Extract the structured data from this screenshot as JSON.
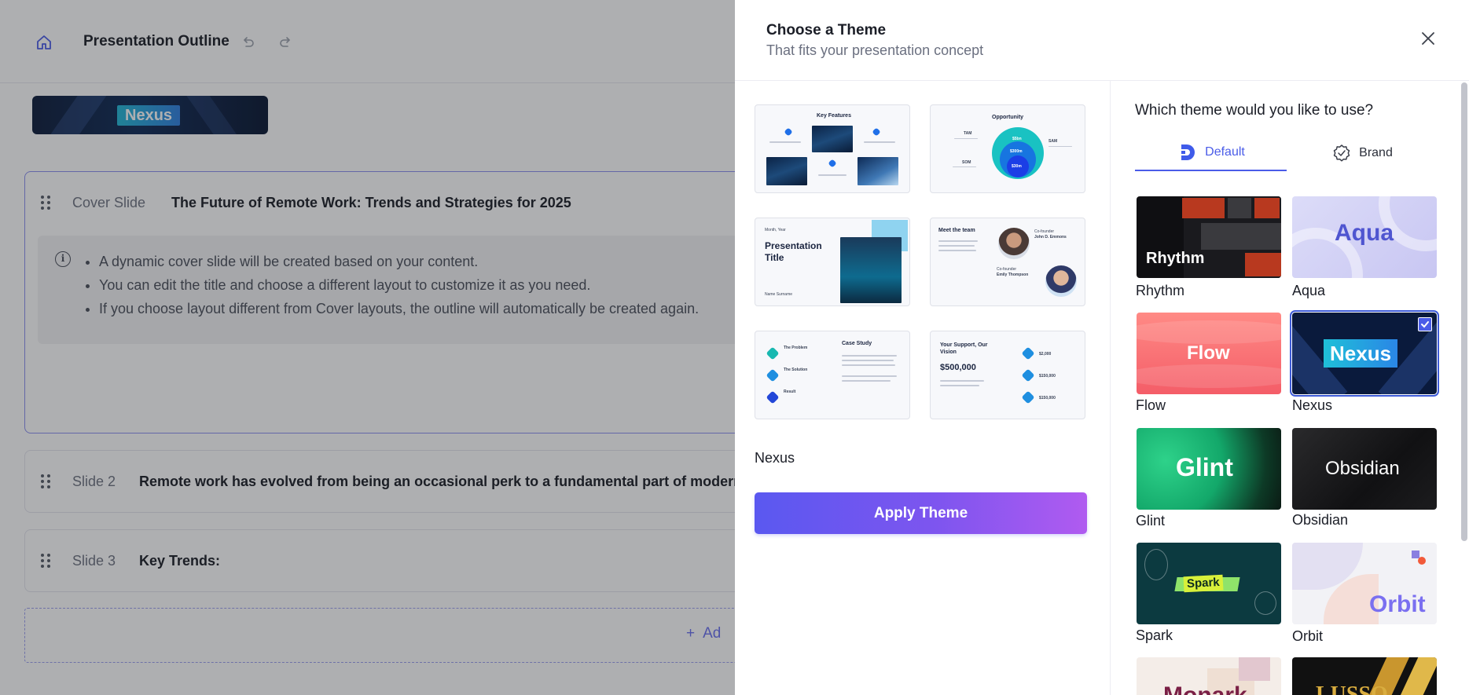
{
  "app": {
    "title": "Presentation Outline",
    "banner_theme": "Nexus",
    "add_slide_label": "Ad"
  },
  "cover": {
    "kind": "Cover Slide",
    "title": "The Future of Remote Work: Trends and Strategies for 2025",
    "info": [
      "A dynamic cover slide will be created based on your content.",
      "You can edit the title and choose a different layout to customize it as you need.",
      "If you choose layout different from Cover layouts, the outline will automatically be created again."
    ]
  },
  "slides": [
    {
      "kind": "Slide 2",
      "title": "Remote work has evolved from being an occasional perk to a fundamental part of modern"
    },
    {
      "kind": "Slide 3",
      "title": "Key Trends:"
    }
  ],
  "panel": {
    "title": "Choose a Theme",
    "subtitle": "That fits your presentation concept",
    "selected_theme": "Nexus",
    "apply_label": "Apply Theme",
    "question": "Which theme would you like to use?",
    "tabs": {
      "default": "Default",
      "brand": "Brand"
    }
  },
  "previews": {
    "key_features": {
      "title": "Key Features"
    },
    "opportunity": {
      "title": "Opportunity",
      "tam": "TAM",
      "sam": "SAM",
      "som": "SOM",
      "v1": "$5bn",
      "v2": "$300m",
      "v3": "$30m"
    },
    "title_slide": {
      "month": "Month, Year",
      "title1": "Presentation",
      "title2": "Title",
      "name": "Name Surname"
    },
    "team": {
      "title": "Meet the team",
      "role1": "Co-founder",
      "name1": "John D. Emmons",
      "role2": "Co-founder",
      "name2": "Emily Thompson"
    },
    "case_study": {
      "title": "Case Study",
      "p1": "The Problem",
      "p2": "The Solution",
      "p3": "Result"
    },
    "support": {
      "title1": "Your Support, Our",
      "title2": "Vision",
      "amount": "$500,000",
      "a1": "$2,000",
      "a2": "$150,000",
      "a3": "$150,000"
    }
  },
  "themes": [
    {
      "name": "Rhythm",
      "tile_text": "Rhythm"
    },
    {
      "name": "Aqua",
      "tile_text": "Aqua"
    },
    {
      "name": "Flow",
      "tile_text": "Flow"
    },
    {
      "name": "Nexus",
      "tile_text": "Nexus",
      "selected": true
    },
    {
      "name": "Glint",
      "tile_text": "Glint"
    },
    {
      "name": "Obsidian",
      "tile_text": "Obsidian"
    },
    {
      "name": "Spark",
      "tile_text": "Spark"
    },
    {
      "name": "Orbit",
      "tile_text": "Orbit"
    },
    {
      "name": "Monark",
      "tile_text": "Monark"
    },
    {
      "name": "Lusso",
      "tile_text": "LUSSO"
    }
  ],
  "colors": {
    "accent": "#4a5ce8",
    "apply_gradient_start": "#5a58f0",
    "apply_gradient_end": "#b05bf0",
    "scrim": "rgba(30,32,40,0.36)"
  }
}
